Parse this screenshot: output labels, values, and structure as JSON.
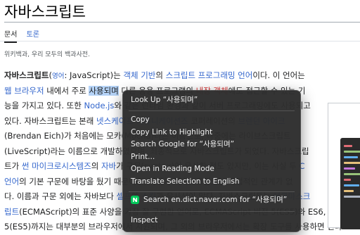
{
  "page": {
    "title": "자바스크립트",
    "tabs": [
      {
        "label": "문서",
        "active": true
      },
      {
        "label": "토론",
        "active": false
      }
    ],
    "tagline": "위키백과, 우리 모두의 백과사전."
  },
  "article": {
    "lines": [
      [
        {
          "t": "자바스크립트",
          "s": "bold"
        },
        {
          "t": "(",
          "s": ""
        },
        {
          "t": "영어",
          "s": "link small"
        },
        {
          "t": ": JavaScript)는 ",
          "s": ""
        },
        {
          "t": "객체 기반",
          "s": "link"
        },
        {
          "t": "의 ",
          "s": ""
        },
        {
          "t": "스크립트 프로그래밍 언어",
          "s": "link"
        },
        {
          "t": "이다. 이 언어는",
          "s": ""
        }
      ],
      [
        {
          "t": "웹 브라우저",
          "s": "link"
        },
        {
          "t": " 내에서 주로 ",
          "s": ""
        },
        {
          "t": "사용되며",
          "s": "sel"
        },
        {
          "t": " 다른 응용 프로그램의 ",
          "s": ""
        },
        {
          "t": "내장 객체",
          "s": "red"
        },
        {
          "t": "에도 접근할 수 있는 기",
          "s": ""
        }
      ],
      [
        {
          "t": "능을 가지고 있다. 또한 ",
          "s": ""
        },
        {
          "t": "Node.js",
          "s": "link"
        },
        {
          "t": "와 같은 런타임 환경과 같이 서버 프로그래밍에도 사용되고",
          "s": ""
        }
      ],
      [
        {
          "t": "있다. 자바스크립트는 본래 ",
          "s": ""
        },
        {
          "t": "넷스케이프 커뮤니케이션즈",
          "s": "link"
        },
        {
          "t": " 코퍼레이션의 ",
          "s": ""
        },
        {
          "t": "브렌던 아이크",
          "s": "link"
        }
      ],
      [
        {
          "t": "(Brendan Eich)가 처음에는 모카(Mocha)라는 이름으로, 나중에는 라이브스크립트",
          "s": ""
        }
      ],
      [
        {
          "t": "(LiveScript)라는 이름으로 개발하였으며, 최종적으로 자바스크립트가 되었다. 자바스크립",
          "s": ""
        }
      ],
      [
        {
          "t": "트가 ",
          "s": ""
        },
        {
          "t": "썬 마이크로시스템즈",
          "s": "link"
        },
        {
          "t": "의 ",
          "s": ""
        },
        {
          "t": "자바",
          "s": "link"
        },
        {
          "t": "가 구문(syntax)이 유사한 점도 있지만, 이는 사실 두 ",
          "s": ""
        },
        {
          "t": "C",
          "s": "link"
        }
      ],
      [
        {
          "t": "언어",
          "s": "link"
        },
        {
          "t": "의 기본 구문에 바탕을 뒀기 때문이고, 자바와 자바스크립트는 직접적인 관계가 없",
          "s": ""
        }
      ],
      [
        {
          "t": "다. 이름과 구문 외에는 자바보다 ",
          "s": ""
        },
        {
          "t": "셀프",
          "s": "link"
        },
        {
          "t": "와 ",
          "s": ""
        },
        {
          "t": "스킴",
          "s": "link"
        },
        {
          "t": "과 유사성이 많다. 자바스크립트는 ",
          "s": ""
        },
        {
          "t": "에크마스크",
          "s": "link"
        }
      ],
      [
        {
          "t": "립트",
          "s": "link"
        },
        {
          "t": "(ECMAScript)의 표준 사양을 가장 잘 구현한 언어로, ECMAScript 버전 5(ES5)와 ES6, Script",
          "s": ""
        }
      ],
      [
        {
          "t": "5(ES5)까지는 대부분의 브라우저에서 지원되며, 그 외의 브라우저에서는 확장 도구를 사용하면 된다",
          "s": ""
        }
      ]
    ]
  },
  "context_menu": {
    "look_up": "Look Up “사용되며”",
    "copy": "Copy",
    "copy_link_highlight": "Copy Link to Highlight",
    "search_google": "Search Google for “사용되며”",
    "print": "Print...",
    "reading_mode": "Open in Reading Mode",
    "translate": "Translate Selection to English",
    "naver_search": "Search en.dict.naver.com for “사용되며”",
    "inspect": "Inspect",
    "naver_icon": "naver-dictionary-icon"
  },
  "colors": {
    "link": "#3366cc",
    "red_link": "#d73333",
    "selection": "#b5d3f7",
    "menu_bg": "#2d2d2d",
    "naver_green": "#03c75a"
  }
}
